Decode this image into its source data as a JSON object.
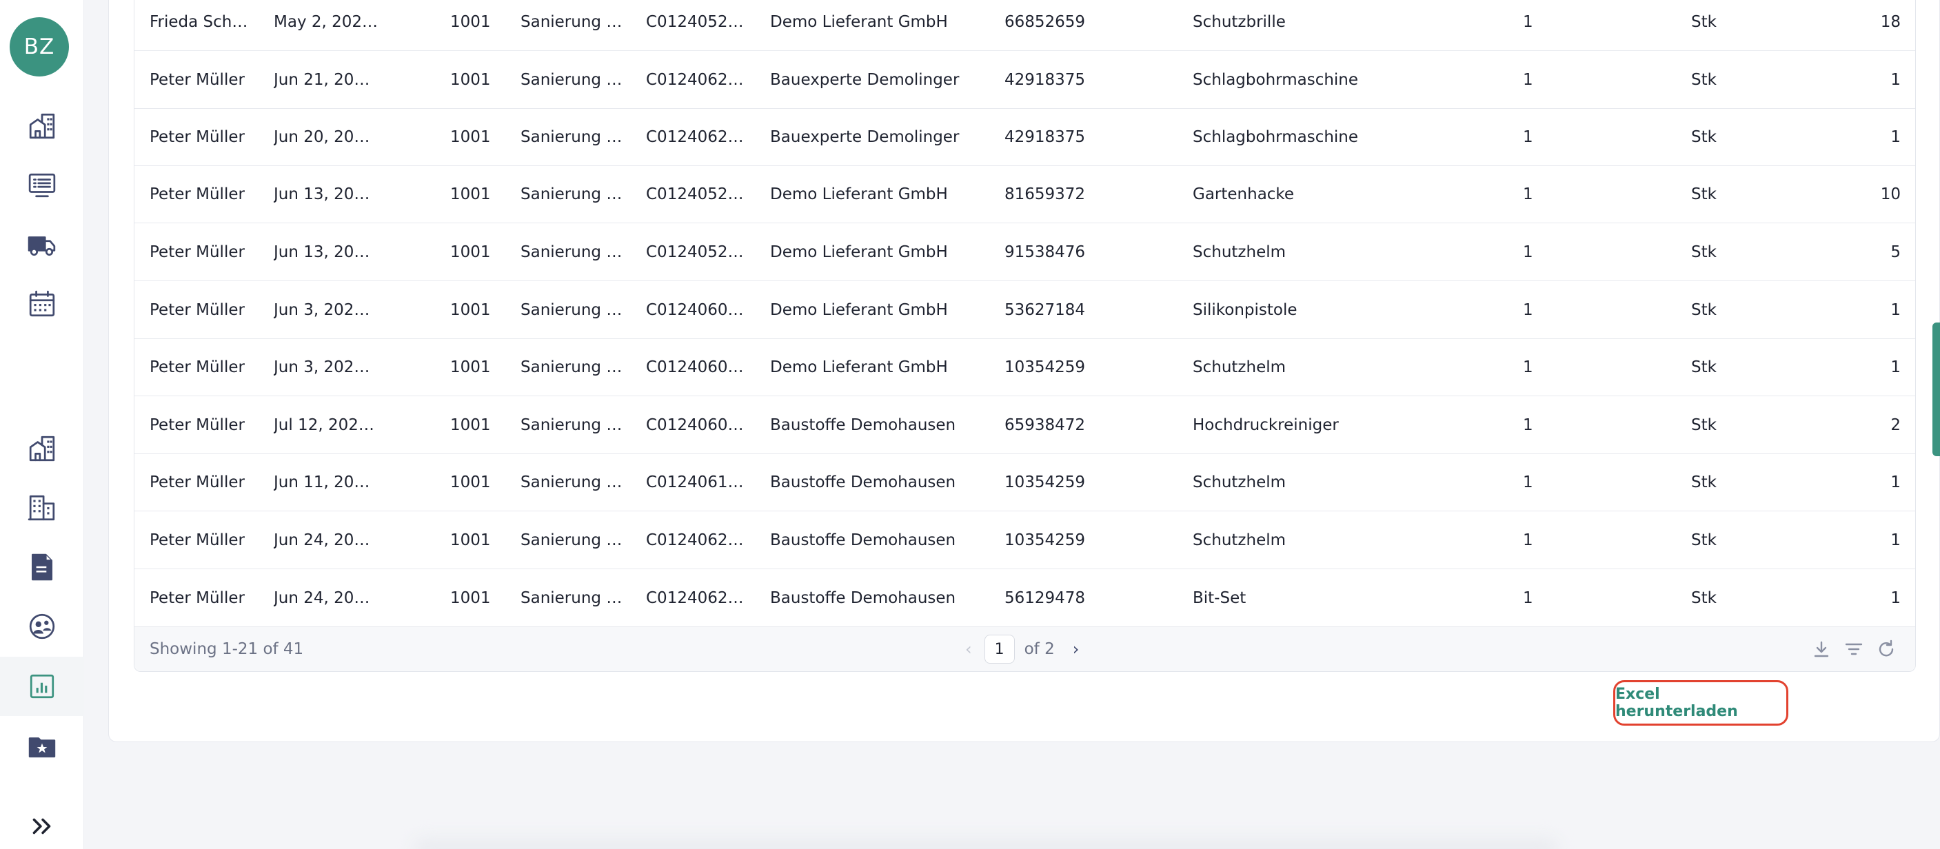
{
  "user": {
    "initials": "BZ"
  },
  "sidebar": {
    "items": [
      {
        "icon": "building-home-icon",
        "active": false
      },
      {
        "icon": "list-board-icon",
        "active": false
      },
      {
        "icon": "truck-icon",
        "active": false
      },
      {
        "icon": "calendar-icon",
        "active": false
      },
      {
        "icon": "building-home-icon",
        "active": false
      },
      {
        "icon": "office-building-icon",
        "active": false
      },
      {
        "icon": "document-icon",
        "active": false
      },
      {
        "icon": "support-agent-icon",
        "active": false
      },
      {
        "icon": "report-chart-icon",
        "active": true
      },
      {
        "icon": "folder-star-icon",
        "active": false
      },
      {
        "icon": "expand-chevrons-icon",
        "active": false
      }
    ],
    "accent": "#3b9380",
    "icon_color": "#414a6e"
  },
  "table": {
    "rows": [
      [
        "Frieda Sch…",
        "May 2, 202…",
        "1001",
        "Sanierung …",
        "C0124052…",
        "Demo Lieferant GmbH",
        "66852659",
        "Schutzbrille",
        "1",
        "Stk",
        "18"
      ],
      [
        "Peter Müller",
        "Jun 21, 20…",
        "1001",
        "Sanierung …",
        "C0124062…",
        "Bauexperte Demolinger",
        "42918375",
        "Schlagbohrmaschine",
        "1",
        "Stk",
        "1"
      ],
      [
        "Peter Müller",
        "Jun 20, 20…",
        "1001",
        "Sanierung …",
        "C0124062…",
        "Bauexperte Demolinger",
        "42918375",
        "Schlagbohrmaschine",
        "1",
        "Stk",
        "1"
      ],
      [
        "Peter Müller",
        "Jun 13, 20…",
        "1001",
        "Sanierung …",
        "C0124052…",
        "Demo Lieferant GmbH",
        "81659372",
        "Gartenhacke",
        "1",
        "Stk",
        "10"
      ],
      [
        "Peter Müller",
        "Jun 13, 20…",
        "1001",
        "Sanierung …",
        "C0124052…",
        "Demo Lieferant GmbH",
        "91538476",
        "Schutzhelm",
        "1",
        "Stk",
        "5"
      ],
      [
        "Peter Müller",
        "Jun 3, 202…",
        "1001",
        "Sanierung …",
        "C0124060…",
        "Demo Lieferant GmbH",
        "53627184",
        "Silikonpistole",
        "1",
        "Stk",
        "1"
      ],
      [
        "Peter Müller",
        "Jun 3, 202…",
        "1001",
        "Sanierung …",
        "C0124060…",
        "Demo Lieferant GmbH",
        "10354259",
        "Schutzhelm",
        "1",
        "Stk",
        "1"
      ],
      [
        "Peter Müller",
        "Jul 12, 202…",
        "1001",
        "Sanierung …",
        "C0124060…",
        "Baustoffe Demohausen",
        "65938472",
        "Hochdruckreiniger",
        "1",
        "Stk",
        "2"
      ],
      [
        "Peter Müller",
        "Jun 11, 20…",
        "1001",
        "Sanierung …",
        "C0124061…",
        "Baustoffe Demohausen",
        "10354259",
        "Schutzhelm",
        "1",
        "Stk",
        "1"
      ],
      [
        "Peter Müller",
        "Jun 24, 20…",
        "1001",
        "Sanierung …",
        "C0124062…",
        "Baustoffe Demohausen",
        "10354259",
        "Schutzhelm",
        "1",
        "Stk",
        "1"
      ],
      [
        "Peter Müller",
        "Jun 24, 20…",
        "1001",
        "Sanierung …",
        "C0124062…",
        "Baustoffe Demohausen",
        "56129478",
        "Bit-Set",
        "1",
        "Stk",
        "1"
      ]
    ]
  },
  "footer": {
    "showing": "Showing 1-21 of 41",
    "prev": "‹",
    "page": "1",
    "of_pages": "of 2",
    "next": "›",
    "tools": [
      "download-icon",
      "filter-icon",
      "refresh-icon"
    ]
  },
  "actions": {
    "excel_label": "Excel herunterladen",
    "highlight_color": "#e2422f"
  }
}
